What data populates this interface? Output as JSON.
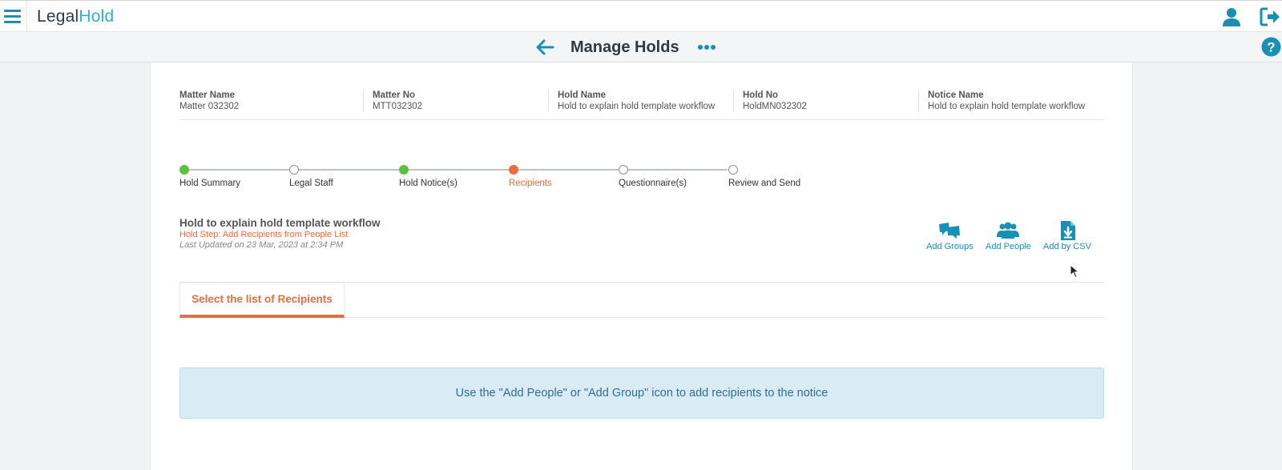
{
  "header": {
    "logo_part1": "Legal",
    "logo_part2": "Hold"
  },
  "subheader": {
    "title": "Manage Holds"
  },
  "info": [
    {
      "label": "Matter Name",
      "value": "Matter 032302"
    },
    {
      "label": "Matter No",
      "value": "MTT032302"
    },
    {
      "label": "Hold Name",
      "value": "Hold to explain hold template workflow"
    },
    {
      "label": "Hold No",
      "value": "HoldMN032302"
    },
    {
      "label": "Notice Name",
      "value": "Hold to explain hold template workflow"
    }
  ],
  "steps": [
    {
      "label": "Hold Summary",
      "state": "done"
    },
    {
      "label": "Legal Staff",
      "state": "pending"
    },
    {
      "label": "Hold Notice(s)",
      "state": "done"
    },
    {
      "label": "Recipients",
      "state": "active"
    },
    {
      "label": "Questionnaire(s)",
      "state": "pending"
    },
    {
      "label": "Review and Send",
      "state": "pending"
    }
  ],
  "hold": {
    "title": "Hold to explain hold template workflow",
    "step": "Hold Step: Add Recipients from People List",
    "updated": "Last Updated on 23 Mar, 2023 at 2:34 PM"
  },
  "actions": {
    "add_groups": "Add Groups",
    "add_people": "Add People",
    "add_csv": "Add by CSV"
  },
  "tabs": {
    "recipients": "Select the list of Recipients"
  },
  "banner": {
    "message": "Use the \"Add People\" or \"Add Group\" icon to add recipients to the notice"
  },
  "colors": {
    "accent": "#1a8fb5",
    "active_step": "#ef6a3d",
    "done_step": "#5cc040",
    "banner_bg": "#d9ebf5"
  }
}
